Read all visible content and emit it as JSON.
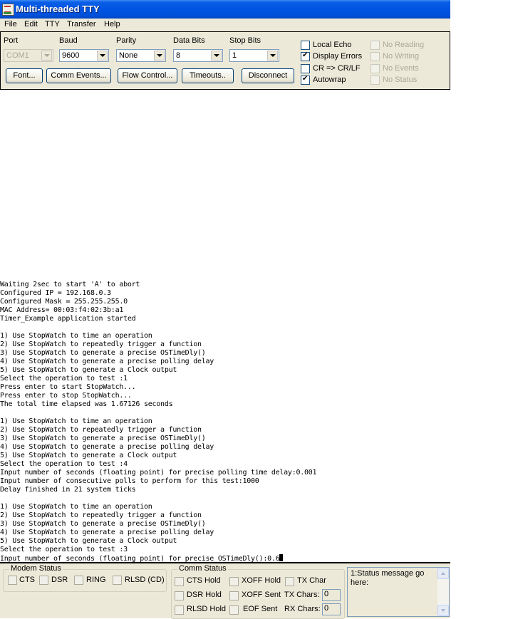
{
  "window": {
    "title": "Multi-threaded TTY",
    "title_bar_color": "#0054e3",
    "face_color": "#ece9d8"
  },
  "menu": [
    "File",
    "Edit",
    "TTY",
    "Transfer",
    "Help"
  ],
  "settings": {
    "port": {
      "label": "Port",
      "value": "COM1",
      "enabled": false
    },
    "baud": {
      "label": "Baud",
      "value": "9600"
    },
    "parity": {
      "label": "Parity",
      "value": "None"
    },
    "data_bits": {
      "label": "Data Bits",
      "value": "8"
    },
    "stop_bits": {
      "label": "Stop Bits",
      "value": "1"
    },
    "buttons": [
      "Font...",
      "Comm Events...",
      "Flow Control...",
      "Timeouts..",
      "Disconnect"
    ],
    "options": [
      {
        "label": "Local Echo",
        "checked": false,
        "enabled": true
      },
      {
        "label": "Display Errors",
        "checked": true,
        "enabled": true
      },
      {
        "label": "CR => CR/LF",
        "checked": false,
        "enabled": true
      },
      {
        "label": "Autowrap",
        "checked": true,
        "enabled": true
      }
    ],
    "disabled_options": [
      {
        "label": "No Reading",
        "checked": false,
        "enabled": false
      },
      {
        "label": "No Writing",
        "checked": false,
        "enabled": false
      },
      {
        "label": "No Events",
        "checked": false,
        "enabled": false
      },
      {
        "label": "No Status",
        "checked": false,
        "enabled": false
      }
    ]
  },
  "terminal": {
    "lines": [
      "Waiting 2sec to start 'A' to abort",
      "Configured IP = 192.168.0.3",
      "Configured Mask = 255.255.255.0",
      "MAC Address= 00:03:f4:02:3b:a1",
      "Timer_Example application started",
      "",
      "1) Use StopWatch to time an operation",
      "2) Use StopWatch to repeatedly trigger a function",
      "3) Use StopWatch to generate a precise OSTimeDly()",
      "4) Use StopWatch to generate a precise polling delay",
      "5) Use StopWatch to generate a Clock output",
      "Select the operation to test :1",
      "Press enter to start StopWatch...",
      "Press enter to stop StopWatch...",
      "The total time elapsed was 1.67126 seconds",
      "",
      "1) Use StopWatch to time an operation",
      "2) Use StopWatch to repeatedly trigger a function",
      "3) Use StopWatch to generate a precise OSTimeDly()",
      "4) Use StopWatch to generate a precise polling delay",
      "5) Use StopWatch to generate a Clock output",
      "Select the operation to test :4",
      "Input number of seconds (floating point) for precise polling time delay:0.001",
      "Input number of consecutive polls to perform for this test:1000",
      "Delay finished in 21 system ticks",
      "",
      "1) Use StopWatch to time an operation",
      "2) Use StopWatch to repeatedly trigger a function",
      "3) Use StopWatch to generate a precise OSTimeDly()",
      "4) Use StopWatch to generate a precise polling delay",
      "5) Use StopWatch to generate a Clock output",
      "Select the operation to test :3",
      "Input number of seconds (floating point) for precise OSTimeDly():0.6"
    ]
  },
  "modem_status": {
    "title": "Modem Status",
    "items": [
      "CTS",
      "DSR",
      "RING",
      "RLSD (CD)"
    ]
  },
  "comm_status": {
    "title": "Comm Status",
    "items": [
      "CTS Hold",
      "XOFF Hold",
      "TX Char",
      "DSR Hold",
      "XOFF Sent",
      "RLSD Hold",
      "EOF Sent"
    ],
    "tx_chars_label": "TX Chars:",
    "tx_chars": "0",
    "rx_chars_label": "RX Chars:",
    "rx_chars": "0"
  },
  "status_message": "1:Status message go here:"
}
